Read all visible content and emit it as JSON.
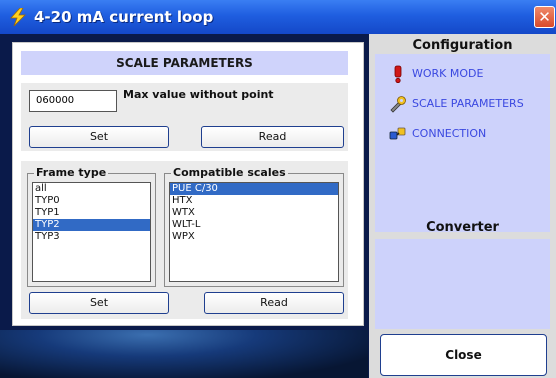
{
  "window": {
    "title": "4-20 mA current loop",
    "close_glyph": "✕",
    "title_icon": "lightning-icon"
  },
  "scale_panel": {
    "header": "SCALE PARAMETERS",
    "max_value": "060000",
    "max_value_label": "Max value without point",
    "set_label": "Set",
    "read_label": "Read"
  },
  "frame_panel": {
    "frame_type_legend": "Frame type",
    "frame_types": [
      "all",
      "TYP0",
      "TYP1",
      "TYP2",
      "TYP3"
    ],
    "selected_frame_type": "TYP2",
    "scales_legend": "Compatible scales",
    "scales": [
      "PUE C/30",
      "HTX",
      "WTX",
      "WLT-L",
      "WPX"
    ],
    "selected_scale": "PUE C/30",
    "set_label": "Set",
    "read_label": "Read"
  },
  "configuration": {
    "title": "Configuration",
    "items": [
      {
        "label": "WORK MODE",
        "icon": "exclamation-icon"
      },
      {
        "label": "SCALE PARAMETERS",
        "icon": "wrench-icon"
      },
      {
        "label": "CONNECTION",
        "icon": "plug-icon"
      }
    ]
  },
  "converter": {
    "title": "Converter"
  },
  "close_label": "Close",
  "colors": {
    "titlebar": "#1f5ee0",
    "panel_accent": "#cdd2fb",
    "selection": "#316ac5",
    "link_text": "#3a48e0"
  }
}
